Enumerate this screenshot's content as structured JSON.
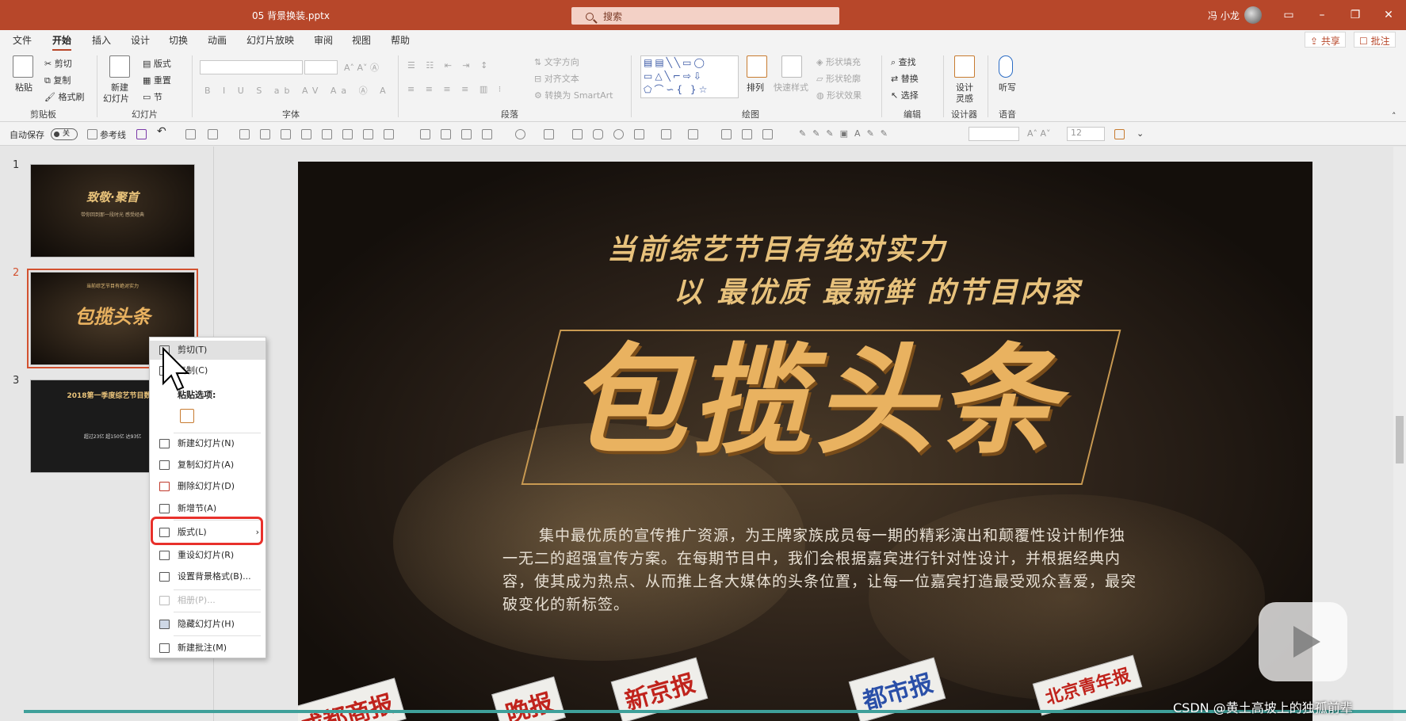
{
  "titlebar": {
    "doc_title": "05 背景换装.pptx",
    "search_placeholder": "搜索",
    "user": "冯 小龙"
  },
  "tabs": [
    "文件",
    "开始",
    "插入",
    "设计",
    "切换",
    "动画",
    "幻灯片放映",
    "审阅",
    "视图",
    "帮助"
  ],
  "active_tab": "开始",
  "share_label": "共享",
  "comment_label": "批注",
  "ribbon": {
    "clipboard": {
      "paste": "粘贴",
      "cut": "剪切",
      "copy": "复制",
      "format_painter": "格式刷",
      "group": "剪贴板"
    },
    "slides": {
      "new_slide": "新建",
      "new_slide2": "幻灯片",
      "layout": "版式",
      "reset": "重置",
      "section": "节",
      "group": "幻灯片"
    },
    "font": {
      "group": "字体"
    },
    "paragraph": {
      "text_direction": "文字方向",
      "align_text": "对齐文本",
      "smartart": "转换为 SmartArt",
      "group": "段落"
    },
    "drawing": {
      "arrange": "排列",
      "quick_styles": "快速样式",
      "shape_fill": "形状填充",
      "shape_outline": "形状轮廓",
      "shape_effects": "形状效果",
      "group": "绘图"
    },
    "editing": {
      "find": "查找",
      "replace": "替换",
      "select": "选择",
      "group": "编辑"
    },
    "designer": {
      "label1": "设计",
      "label2": "灵感",
      "group": "设计器"
    },
    "voice": {
      "label": "听写",
      "group": "语音"
    }
  },
  "qat": {
    "autosave": "自动保存",
    "toggle": "关",
    "gridlines": "参考线",
    "font_size": "12"
  },
  "slides_panel": [
    {
      "num": "1",
      "title": "致敬·聚首",
      "sub": "带你回到那一段时光 感受经典"
    },
    {
      "num": "2",
      "title": "包揽头条",
      "sub": "当前综艺节目有绝对实力"
    },
    {
      "num": "3",
      "title": "2018第一季度综艺节目数据",
      "sub": "超过23亿  超150亿  达93亿"
    }
  ],
  "context_menu": {
    "cut": "剪切(T)",
    "copy": "复制(C)",
    "paste_options": "粘贴选项:",
    "new_slide": "新建幻灯片(N)",
    "duplicate_slide": "复制幻灯片(A)",
    "delete_slide": "删除幻灯片(D)",
    "new_section": "新增节(A)",
    "layout": "版式(L)",
    "reset_slide": "重设幻灯片(R)",
    "format_background": "设置背景格式(B)...",
    "photo_album": "相册(P)...",
    "hide_slide": "隐藏幻灯片(H)",
    "new_comment": "新建批注(M)"
  },
  "slide": {
    "heading1": "当前综艺节目有绝对实力",
    "heading2": "以 最优质 最新鲜 的节目内容",
    "big_title": "包揽头条",
    "body": "集中最优质的宣传推广资源，为王牌家族成员每一期的精彩演出和颠覆性设计制作独一无二的超强宣传方案。在每期节目中，我们会根据嘉宾进行针对性设计，并根据经典内容，使其成为热点、从而推上各大媒体的头条位置，让每一位嘉宾打造最受观众喜爱，最突破变化的新标签。",
    "papers": [
      "成都商报",
      "晚报",
      "新京报",
      "都市报",
      "北京青年报"
    ]
  },
  "watermark": "CSDN @黄土高坡上的独孤前辈"
}
